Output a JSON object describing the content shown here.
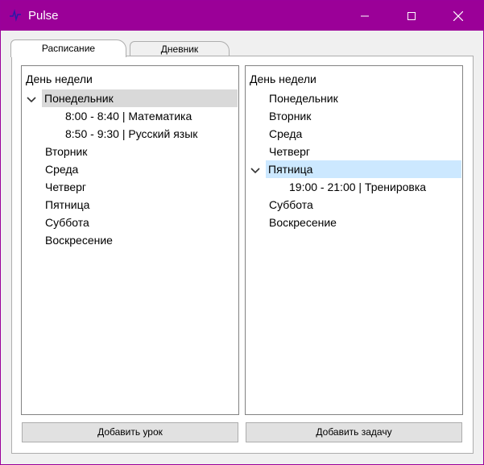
{
  "window": {
    "title": "Pulse",
    "accent": "#9b0098"
  },
  "tabs": [
    {
      "label": "Расписание",
      "active": true
    },
    {
      "label": "Дневник",
      "active": false
    }
  ],
  "schedule": {
    "header": "День недели",
    "days": [
      "Понедельник",
      "Вторник",
      "Среда",
      "Четверг",
      "Пятница",
      "Суббота",
      "Воскресение"
    ],
    "expanded_day": "Понедельник",
    "entries": [
      "8:00 - 8:40 | Математика",
      "8:50 - 9:30 | Русский язык"
    ],
    "add_button": "Добавить урок"
  },
  "diary": {
    "header": "День недели",
    "days": [
      "Понедельник",
      "Вторник",
      "Среда",
      "Четверг",
      "Пятница",
      "Суббота",
      "Воскресение"
    ],
    "expanded_day": "Пятница",
    "entries": [
      "19:00 - 21:00 | Тренировка"
    ],
    "add_button": "Добавить задачу"
  }
}
